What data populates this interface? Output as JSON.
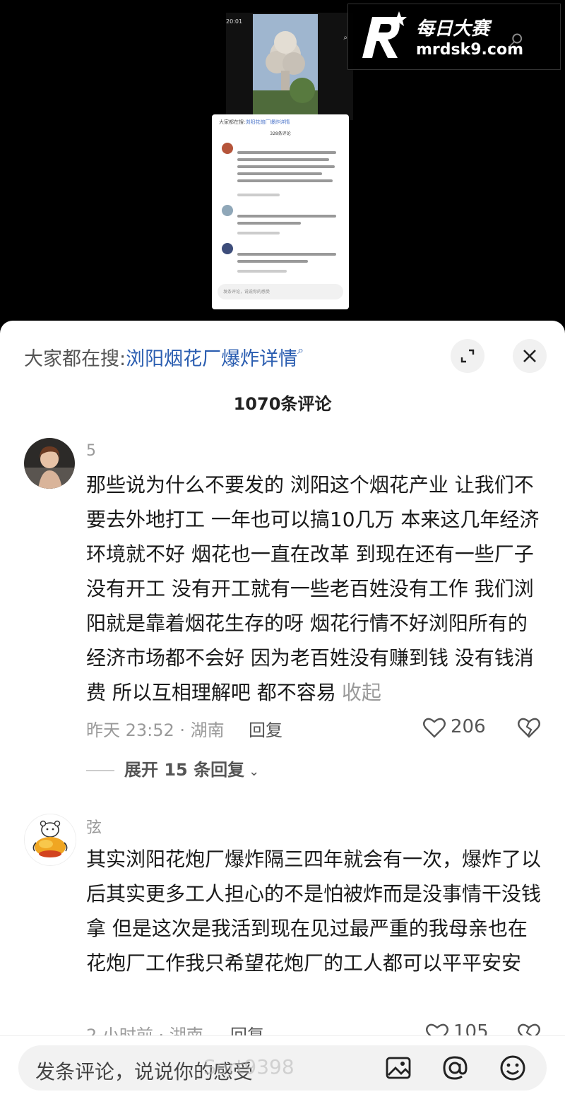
{
  "video": {
    "time": "20:01",
    "mini_search_prefix": "大家都在搜:",
    "mini_search_term": "浏阳花炮厂爆炸详情",
    "mini_count": "328条评论",
    "mini_input": "发条评论，说说你的感受"
  },
  "watermark": {
    "title": "每日大赛",
    "url": "mrdsk9.com"
  },
  "sheet": {
    "search_prefix": "大家都在搜:",
    "search_term": "浏阳烟花厂爆炸详情",
    "comment_count": "1070条评论"
  },
  "comments": [
    {
      "username": "5",
      "text": "那些说为什么不要发的 浏阳这个烟花产业 让我们不要去外地打工 一年也可以搞10几万 本来这几年经济环境就不好 烟花也一直在改革 到现在还有一些厂子没有开工 没有开工就有一些老百姓没有工作 我们浏阳就是靠着烟花生存的呀 烟花行情不好浏阳所有的经济市场都不会好  因为老百姓没有赚到钱 没有钱消费 所以互相理解吧 都不容易",
      "collapse_label": "收起",
      "meta": "昨天 23:52 · 湖南",
      "reply_label": "回复",
      "likes": "206",
      "expand_label": "展开 15 条回复"
    },
    {
      "username": "弦",
      "text": "其实浏阳花炮厂爆炸隔三四年就会有一次，爆炸了以后其实更多工人担心的不是怕被炸而是没事情干没钱拿 但是这次是我活到现在见过最严重的我母亲也在花炮厂工作我只希望花炮厂的工人都可以平平安安",
      "meta": "2 小时前 · 湖南",
      "reply_label": "回复",
      "likes": "105"
    }
  ],
  "input_bar": {
    "placeholder": "发条评论，说说你的感受",
    "overlay_watermark": "Sort9398"
  },
  "icons": [
    "expand-icon",
    "close-icon",
    "heart-icon",
    "dislike-icon",
    "image-icon",
    "at-icon",
    "emoji-icon",
    "search-icon"
  ],
  "colors": {
    "link": "#2a5db0",
    "muted": "#9a9a9a",
    "text": "#1a1a1a"
  }
}
